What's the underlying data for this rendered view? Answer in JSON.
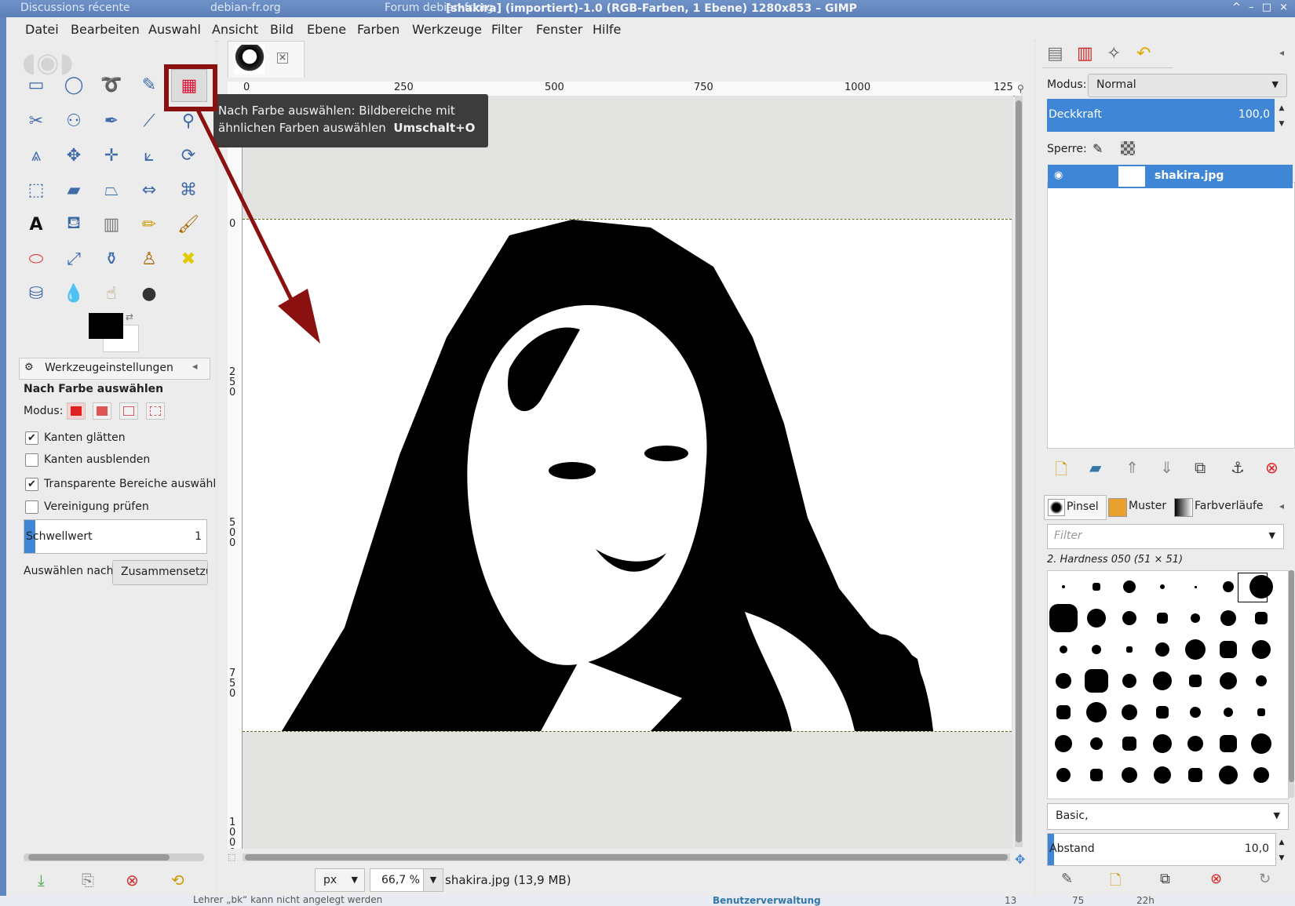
{
  "window": {
    "browser_tabs": [
      "Discussions récente",
      "debian-fr.org",
      "Forum debian-fr.org"
    ],
    "title": "[shakira] (importiert)-1.0 (RGB-Farben, 1 Ebene) 1280x853 – GIMP"
  },
  "menu": [
    "Datei",
    "Bearbeiten",
    "Auswahl",
    "Ansicht",
    "Bild",
    "Ebene",
    "Farben",
    "Werkzeuge",
    "Filter",
    "Fenster",
    "Hilfe"
  ],
  "tooltip": {
    "line1": "Nach Farbe auswählen: Bildbereiche mit",
    "line2": "ähnlichen Farben auswählen",
    "shortcut": "Umschalt+O"
  },
  "tool_options": {
    "tab_label": "Werkzeugeinstellungen",
    "tool_name": "Nach Farbe auswählen",
    "mode_label": "Modus:",
    "checkboxes": [
      {
        "label": "Kanten glätten",
        "checked": true
      },
      {
        "label": "Kanten ausblenden",
        "checked": false
      },
      {
        "label": "Transparente Bereiche auswähl",
        "checked": true
      },
      {
        "label": "Vereinigung prüfen",
        "checked": false
      }
    ],
    "threshold_label": "Schwellwert",
    "threshold_value": "1",
    "select_by_label": "Auswählen nach:",
    "select_by_value": "Zusammensetzu"
  },
  "ruler": {
    "h_marks": [
      "0",
      "250",
      "500",
      "750",
      "1000",
      "125"
    ],
    "v_marks": [
      "0",
      "250",
      "500",
      "750",
      "1000"
    ]
  },
  "status": {
    "unit": "px",
    "zoom": "66,7 %",
    "file_info": "shakira.jpg (13,9 MB)"
  },
  "layers": {
    "mode_label": "Modus:",
    "mode_value": "Normal",
    "opacity_label": "Deckkraft",
    "opacity_value": "100,0",
    "lock_label": "Sperre:",
    "layer_name": "shakira.jpg"
  },
  "brushes": {
    "tabs": [
      "Pinsel",
      "Muster",
      "Farbverläufe"
    ],
    "filter_placeholder": "Filter",
    "selected_brush": "2. Hardness 050 (51 × 51)",
    "preset": "Basic,",
    "spacing_label": "Abstand",
    "spacing_value": "10,0"
  },
  "taskbar": {
    "text1": "Lehrer „bk“ kann nicht angelegt werden",
    "text2": "Benutzerverwaltung",
    "nums": [
      "13",
      "75",
      "22h"
    ]
  },
  "colors": {
    "accent": "#3f87d6",
    "annotation": "#8b1010",
    "titlebar": "#5b7fb8"
  }
}
